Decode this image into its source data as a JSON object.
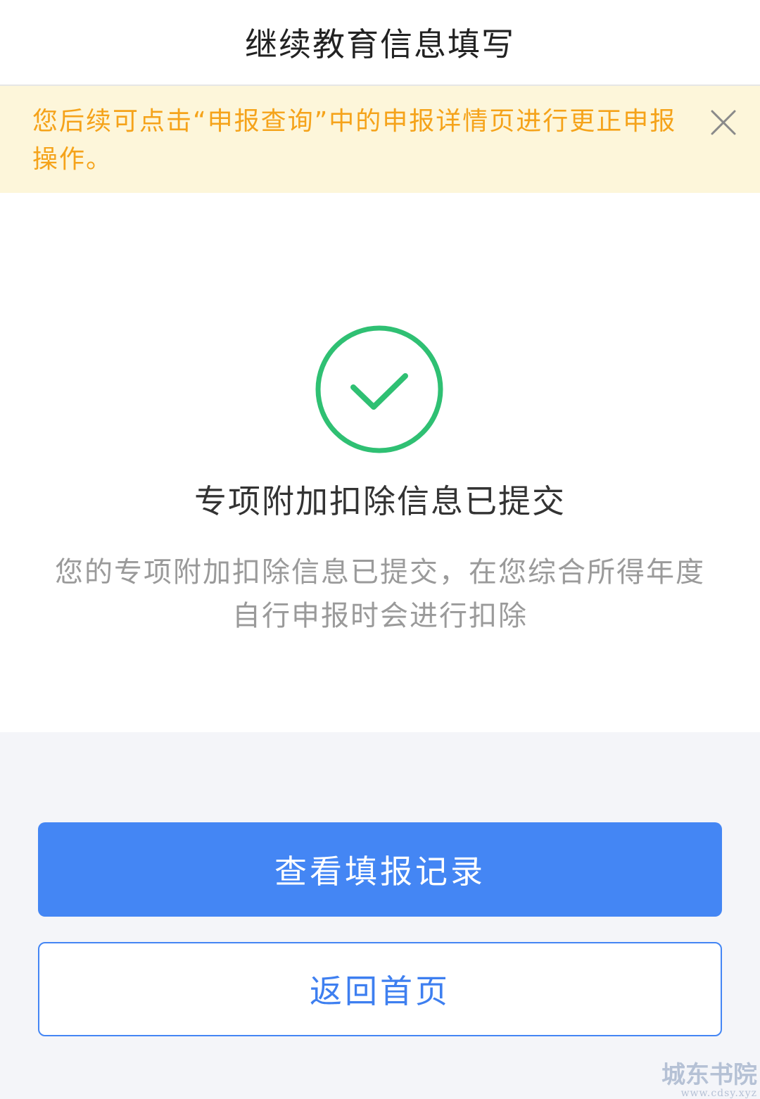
{
  "header": {
    "title": "继续教育信息填写"
  },
  "notice": {
    "text": "您后续可点击“申报查询”中的申报详情页进行更正申报操作。",
    "close_icon": "close-icon",
    "text_color": "#f5a31a",
    "background": "#fdf6da"
  },
  "result": {
    "icon": "check-circle-icon",
    "icon_color": "#2fc073",
    "heading": "专项附加扣除信息已提交",
    "description": "您的专项附加扣除信息已提交，在您综合所得年度自行申报时会进行扣除"
  },
  "actions": {
    "primary_label": "查看填报记录",
    "secondary_label": "返回首页",
    "accent": "#4486f4"
  },
  "watermark": {
    "line1": "城东书院",
    "line2": "www.cdsy.xyz"
  }
}
